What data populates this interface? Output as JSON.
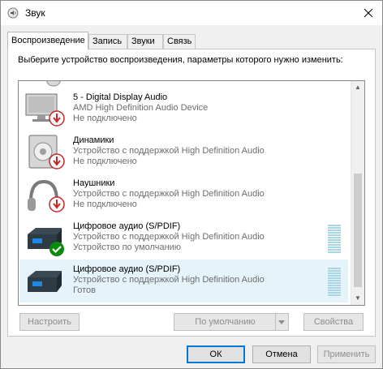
{
  "window": {
    "title": "Звук"
  },
  "tabs": [
    {
      "label": "Воспроизведение"
    },
    {
      "label": "Запись"
    },
    {
      "label": "Звуки"
    },
    {
      "label": "Связь"
    }
  ],
  "panel": {
    "instruction": "Выберите устройство воспроизведения, параметры которого нужно изменить:"
  },
  "devices": [
    {
      "name": "5 - Digital Display Audio",
      "driver": "AMD High Definition Audio Device",
      "status": "Не подключено",
      "icon": "monitor-speaker-icon",
      "badge": "disconnected-badge-icon"
    },
    {
      "name": "Динамики",
      "driver": "Устройство с поддержкой High Definition Audio",
      "status": "Не подключено",
      "icon": "speaker-icon",
      "badge": "disconnected-badge-icon"
    },
    {
      "name": "Наушники",
      "driver": "Устройство с поддержкой High Definition Audio",
      "status": "Не подключено",
      "icon": "headphones-icon",
      "badge": "disconnected-badge-icon"
    },
    {
      "name": "Цифровое аудио (S/PDIF)",
      "driver": "Устройство с поддержкой High Definition Audio",
      "status": "Устройство по умолчанию",
      "icon": "digital-audio-icon",
      "badge": "default-check-icon"
    },
    {
      "name": "Цифровое аудио (S/PDIF)",
      "driver": "Устройство с поддержкой High Definition Audio",
      "status": "Готов",
      "icon": "digital-audio-icon",
      "badge": ""
    }
  ],
  "buttons": {
    "configure": "Настроить",
    "set_default": "По умолчанию",
    "properties": "Свойства",
    "ok": "ОК",
    "cancel": "Отмена",
    "apply": "Применить"
  },
  "colors": {
    "accent": "#0078d7",
    "selected_row": "#e5f3fb",
    "meter": "#a9d6e6",
    "disconnected": "#d32f2f",
    "default_check": "#0a8a0a"
  }
}
